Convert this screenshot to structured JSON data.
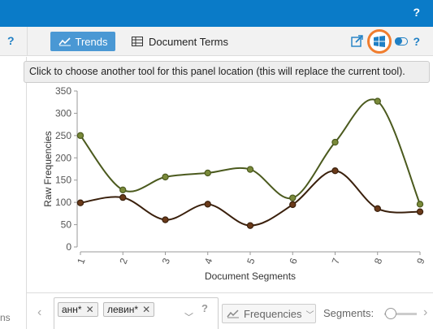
{
  "topbar": {
    "help": "?"
  },
  "subbar": {
    "left_help": "?",
    "tabs": [
      {
        "label": "Trends",
        "active": true
      },
      {
        "label": "Document Terms",
        "active": false
      }
    ],
    "right_help": "?"
  },
  "tooltip": {
    "text": "Click to choose another tool for this panel location (this will replace the current tool)."
  },
  "left_panel": {
    "stub_text": "ns"
  },
  "chart_data": {
    "type": "line",
    "xlabel": "Document Segments",
    "ylabel": "Raw Frequencies",
    "x": [
      1,
      2,
      3,
      4,
      5,
      6,
      7,
      8,
      9
    ],
    "ylim": [
      0,
      350
    ],
    "yticks": [
      0,
      50,
      100,
      150,
      200,
      250,
      300,
      350
    ],
    "series": [
      {
        "name": "анн*",
        "color": "#4b5a1e",
        "values": [
          250,
          128,
          157,
          166,
          174,
          110,
          235,
          327,
          96
        ]
      },
      {
        "name": "левин*",
        "color": "#3a200c",
        "values": [
          99,
          111,
          61,
          96,
          48,
          95,
          171,
          86,
          79
        ]
      }
    ],
    "grid": false
  },
  "bottom": {
    "terms": [
      {
        "label": "анн*"
      },
      {
        "label": "левин*"
      }
    ],
    "help": "?",
    "freq_label": "Frequencies",
    "segments_label": "Segments:"
  }
}
